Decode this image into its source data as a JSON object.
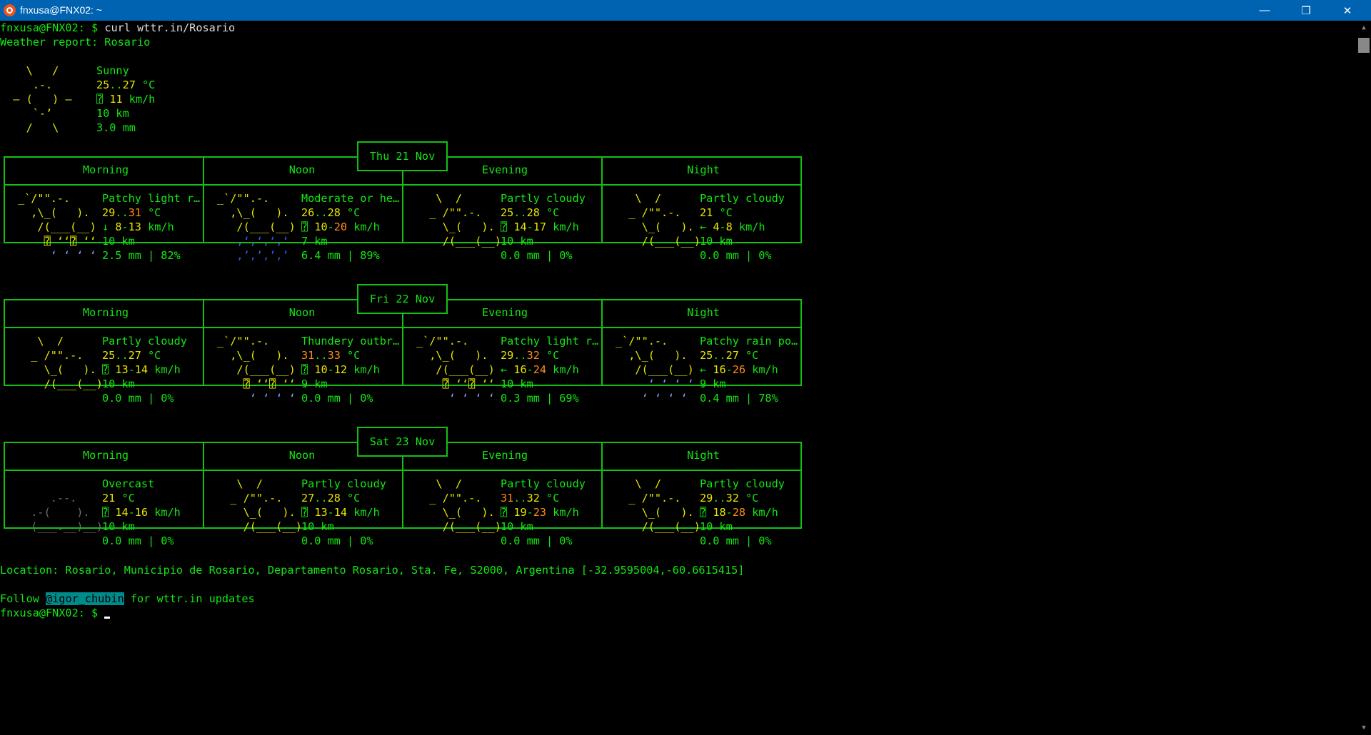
{
  "window": {
    "title": "fnxusa@FNX02: ~",
    "minimize": "—",
    "maximize": "❐",
    "close": "✕"
  },
  "prompt": "fnxusa@FNX02: $",
  "command": "curl wttr.in/Rosario",
  "report_header": "Weather report: Rosario",
  "current": {
    "art": [
      "    \\   /",
      "     .-.",
      "  ― (   ) ―",
      "     `-’",
      "    /   \\"
    ],
    "desc": "Sunny",
    "temp_a": "25",
    "temp_b": "27",
    "temp_unit": " °C",
    "wind_icon": "⍰",
    "wind_speed": "11",
    "wind_unit": " km/h",
    "visibility": "10 km",
    "precip": "3.0 mm"
  },
  "period_labels": [
    "Morning",
    "Noon",
    "Evening",
    "Night"
  ],
  "days": [
    {
      "date": "Thu 21 Nov",
      "periods": [
        {
          "art": [
            "_`/\"\".-.",
            "  ,\\_(   ).",
            "   /(___(__)",
            "    ⍰ ‘‘⍰ ‘‘",
            "     ‘ ‘ ‘ ‘"
          ],
          "art_colors": [
            "y",
            "y",
            "y",
            "y",
            "lb"
          ],
          "desc": "Patchy light r…",
          "t1": "29",
          "t2": "31",
          "t1c": "y",
          "t2c": "o",
          "wind_dir": "↓",
          "w1": "8",
          "w2": "13",
          "precip": "2.5 mm | 82%"
        },
        {
          "art": [
            "_`/\"\".-.",
            "  ,\\_(   ).",
            "   /(___(__)",
            "   ‚‘‚‘‚‘‚‘",
            "   ‚’‚’‚’‚’"
          ],
          "art_colors": [
            "y",
            "y",
            "y",
            "b",
            "b"
          ],
          "desc": "Moderate or he…",
          "t1": "26",
          "t2": "28",
          "t1c": "y",
          "t2c": "y",
          "wind_dir": "⍰",
          "w1": "10",
          "w2": "20",
          "precip": "6.4 mm | 89%"
        },
        {
          "art": [
            "   \\  /",
            "  _ /\"\".-.",
            "    \\_(   ).",
            "    /(___(__)",
            ""
          ],
          "art_colors": [
            "y",
            "y",
            "y",
            "y",
            "y"
          ],
          "desc": "Partly cloudy",
          "t1": "25",
          "t2": "28",
          "t1c": "y",
          "t2c": "y",
          "wind_dir": "⍰",
          "w1": "14",
          "w2": "17",
          "precip": "0.0 mm | 0%"
        },
        {
          "art": [
            "   \\  /",
            "  _ /\"\".-.",
            "    \\_(   ).",
            "    /(___(__)",
            ""
          ],
          "art_colors": [
            "y",
            "y",
            "y",
            "y",
            "y"
          ],
          "desc": "Partly cloudy",
          "t1": "21",
          "t2": "",
          "t1c": "y",
          "t2c": "y",
          "wind_dir": "←",
          "w1": "4",
          "w2": "8",
          "precip": "0.0 mm | 0%"
        }
      ]
    },
    {
      "date": "Fri 22 Nov",
      "periods": [
        {
          "art": [
            "   \\  /",
            "  _ /\"\".-.",
            "    \\_(   ).",
            "    /(___(__)",
            ""
          ],
          "art_colors": [
            "y",
            "y",
            "y",
            "y",
            "y"
          ],
          "desc": "Partly cloudy",
          "t1": "25",
          "t2": "27",
          "t1c": "y",
          "t2c": "y",
          "wind_dir": "⍰",
          "w1": "13",
          "w2": "14",
          "precip": "0.0 mm | 0%"
        },
        {
          "art": [
            "_`/\"\".-.",
            "  ,\\_(   ).",
            "   /(___(__)",
            "    ⍰ ‘‘⍰ ‘‘",
            "     ‘ ‘ ‘ ‘"
          ],
          "art_colors": [
            "y",
            "y",
            "y",
            "y",
            "lb"
          ],
          "desc": "Thundery outbr…",
          "t1": "31",
          "t2": "33",
          "t1c": "o",
          "t2c": "o",
          "wind_dir": "⍰",
          "w1": "10",
          "w2": "12",
          "precip": "0.0 mm | 0%"
        },
        {
          "art": [
            "_`/\"\".-.",
            "  ,\\_(   ).",
            "   /(___(__)",
            "    ⍰ ‘‘⍰ ‘‘",
            "     ‘ ‘ ‘ ‘"
          ],
          "art_colors": [
            "y",
            "y",
            "y",
            "y",
            "lb"
          ],
          "desc": "Patchy light r…",
          "t1": "29",
          "t2": "32",
          "t1c": "y",
          "t2c": "o",
          "wind_dir": "←",
          "w1": "16",
          "w2": "24",
          "precip": "0.3 mm | 69%"
        },
        {
          "art": [
            "_`/\"\".-.",
            "  ,\\_(   ).",
            "   /(___(__)",
            "     ‘ ‘ ‘ ‘",
            "    ‘ ‘ ‘ ‘"
          ],
          "art_colors": [
            "y",
            "y",
            "y",
            "lb",
            "lb"
          ],
          "desc": "Patchy rain po…",
          "t1": "25",
          "t2": "27",
          "t1c": "y",
          "t2c": "y",
          "wind_dir": "←",
          "w1": "16",
          "w2": "26",
          "precip": "0.4 mm | 78%"
        }
      ]
    },
    {
      "date": "Sat 23 Nov",
      "periods": [
        {
          "art": [
            "",
            "     .--.",
            "  .-(    ).",
            "  (___.__)__)",
            ""
          ],
          "art_colors": [
            "gy",
            "gy",
            "gy",
            "gy",
            "gy"
          ],
          "desc": "Overcast",
          "t1": "21",
          "t2": "",
          "t1c": "y",
          "t2c": "y",
          "wind_dir": "⍰",
          "w1": "14",
          "w2": "16",
          "precip": "0.0 mm | 0%"
        },
        {
          "art": [
            "   \\  /",
            "  _ /\"\".-.",
            "    \\_(   ).",
            "    /(___(__)",
            ""
          ],
          "art_colors": [
            "y",
            "y",
            "y",
            "y",
            "y"
          ],
          "desc": "Partly cloudy",
          "t1": "27",
          "t2": "28",
          "t1c": "y",
          "t2c": "y",
          "wind_dir": "⍰",
          "w1": "13",
          "w2": "14",
          "precip": "0.0 mm | 0%"
        },
        {
          "art": [
            "   \\  /",
            "  _ /\"\".-.",
            "    \\_(   ).",
            "    /(___(__)",
            ""
          ],
          "art_colors": [
            "y",
            "y",
            "y",
            "y",
            "y"
          ],
          "desc": "Partly cloudy",
          "t1": "31",
          "t2": "32",
          "t1c": "o",
          "t2c": "y",
          "wind_dir": "⍰",
          "w1": "19",
          "w2": "23",
          "precip": "0.0 mm | 0%"
        },
        {
          "art": [
            "   \\  /",
            "  _ /\"\".-.",
            "    \\_(   ).",
            "    /(___(__)",
            ""
          ],
          "art_colors": [
            "y",
            "y",
            "y",
            "y",
            "y"
          ],
          "desc": "Partly cloudy",
          "t1": "29",
          "t2": "32",
          "t1c": "y",
          "t2c": "y",
          "wind_dir": "⍰",
          "w1": "18",
          "w2": "28",
          "precip": "0.0 mm | 0%"
        }
      ]
    }
  ],
  "location": "Location: Rosario, Municipio de Rosario, Departamento Rosario, Sta. Fe, S2000, Argentina [-32.9595004,-60.6615415]",
  "follow_prefix": "Follow ",
  "follow_handle": "@igor_chubin",
  "follow_suffix": " for wttr.in updates"
}
